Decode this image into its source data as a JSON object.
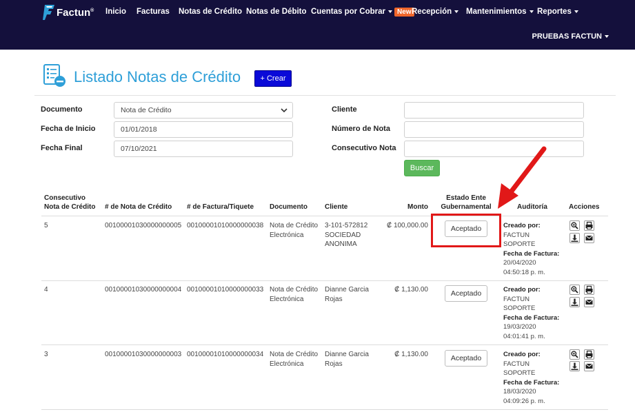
{
  "brand": {
    "name": "Factun",
    "mark": "®"
  },
  "nav": {
    "items": [
      {
        "label": "Inicio"
      },
      {
        "label": "Facturas"
      },
      {
        "label": "Notas de Crédito"
      },
      {
        "label": "Notas de Débito"
      },
      {
        "label": "Cuentas por Cobrar",
        "badge": "New"
      },
      {
        "label": "Recepción"
      },
      {
        "label": "Mantenimientos"
      },
      {
        "label": "Reportes"
      }
    ],
    "user": "PRUEBAS FACTUN"
  },
  "page": {
    "title": "Listado Notas de Crédito",
    "create_label": "+ Crear"
  },
  "filters": {
    "documento": {
      "label": "Documento",
      "value": "Nota de Crédito"
    },
    "fecha_inicio": {
      "label": "Fecha de Inicio",
      "value": "01/01/2018"
    },
    "fecha_final": {
      "label": "Fecha Final",
      "value": "07/10/2021"
    },
    "cliente": {
      "label": "Cliente",
      "value": ""
    },
    "numero_nota": {
      "label": "Número de Nota",
      "value": ""
    },
    "consecutivo_nota": {
      "label": "Consecutivo Nota",
      "value": ""
    },
    "search_label": "Buscar"
  },
  "table": {
    "headers": {
      "consecutivo": "Consecutivo Nota de Crédito",
      "numero_nota": "# de Nota de Crédito",
      "numero_factura": "# de Factura/Tiquete",
      "documento": "Documento",
      "cliente": "Cliente",
      "monto": "Monto",
      "estado": "Estado Ente Gubernamental",
      "auditoria": "Auditoría",
      "acciones": "Acciones"
    },
    "audit_labels": {
      "creado": "Creado por:",
      "fecha": "Fecha de Factura:"
    },
    "rows": [
      {
        "consecutivo": "5",
        "numero_nota": "00100001030000000005",
        "numero_factura": "00100001010000000038",
        "documento": "Nota de Crédito Electrónica",
        "cliente": "3-101-572812 SOCIEDAD ANONIMA",
        "monto": "₡ 100,000.00",
        "estado": "Aceptado",
        "creado_por": "FACTUN SOPORTE",
        "fecha_factura": "20/04/2020 04:50:18 p. m."
      },
      {
        "consecutivo": "4",
        "numero_nota": "00100001030000000004",
        "numero_factura": "00100001010000000033",
        "documento": "Nota de Crédito Electrónica",
        "cliente": "Dianne Garcia Rojas",
        "monto": "₡ 1,130.00",
        "estado": "Aceptado",
        "creado_por": "FACTUN SOPORTE",
        "fecha_factura": "19/03/2020 04:01:41 p. m."
      },
      {
        "consecutivo": "3",
        "numero_nota": "00100001030000000003",
        "numero_factura": "00100001010000000034",
        "documento": "Nota de Crédito Electrónica",
        "cliente": "Dianne Garcia Rojas",
        "monto": "₡ 1,130.00",
        "estado": "Aceptado",
        "creado_por": "FACTUN SOPORTE",
        "fecha_factura": "18/03/2020 04:09:26 p. m."
      }
    ]
  },
  "icons": {
    "brand": "factun-logo-icon",
    "page": "document-list-icon",
    "actions": [
      "zoom-icon",
      "print-icon",
      "download-icon",
      "email-icon"
    ]
  },
  "colors": {
    "navbar": "#14103c",
    "title": "#2e9fd8",
    "create_button": "#0a0ad8",
    "search_button": "#5cb85c",
    "new_badge": "#f0662b",
    "annotation": "#e11818"
  }
}
